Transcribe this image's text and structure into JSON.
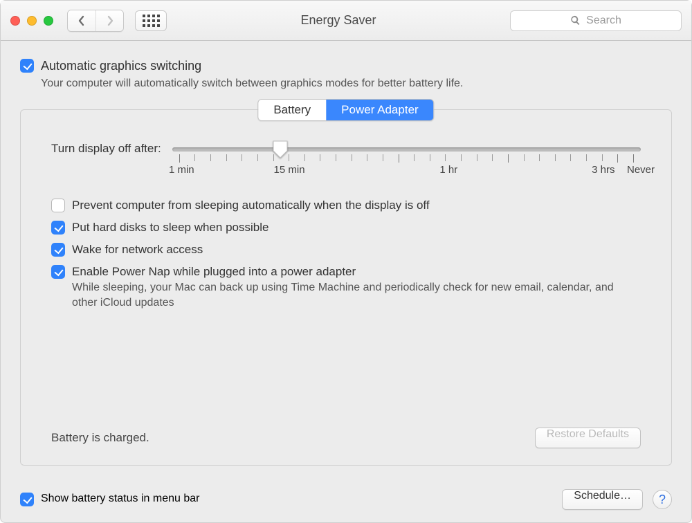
{
  "window": {
    "title": "Energy Saver"
  },
  "search": {
    "placeholder": "Search"
  },
  "autoGraphics": {
    "checked": true,
    "label": "Automatic graphics switching",
    "desc": "Your computer will automatically switch between graphics modes for better battery life."
  },
  "tabs": {
    "battery": "Battery",
    "powerAdapter": "Power Adapter",
    "selected": "powerAdapter"
  },
  "slider": {
    "label": "Turn display off after:",
    "valuePct": 23,
    "ticks": {
      "min": "1 min",
      "fifteen": "15 min",
      "hour": "1 hr",
      "three": "3 hrs",
      "never": "Never"
    }
  },
  "opts": {
    "preventSleep": {
      "checked": false,
      "label": "Prevent computer from sleeping automatically when the display is off"
    },
    "hardDisks": {
      "checked": true,
      "label": "Put hard disks to sleep when possible"
    },
    "wakeNet": {
      "checked": true,
      "label": "Wake for network access"
    },
    "powerNap": {
      "checked": true,
      "label": "Enable Power Nap while plugged into a power adapter",
      "desc": "While sleeping, your Mac can back up using Time Machine and periodically check for new email, calendar, and other iCloud updates"
    }
  },
  "status": "Battery is charged.",
  "buttons": {
    "restore": "Restore Defaults",
    "schedule": "Schedule…"
  },
  "footer": {
    "showBattery": {
      "checked": true,
      "label": "Show battery status in menu bar"
    }
  }
}
